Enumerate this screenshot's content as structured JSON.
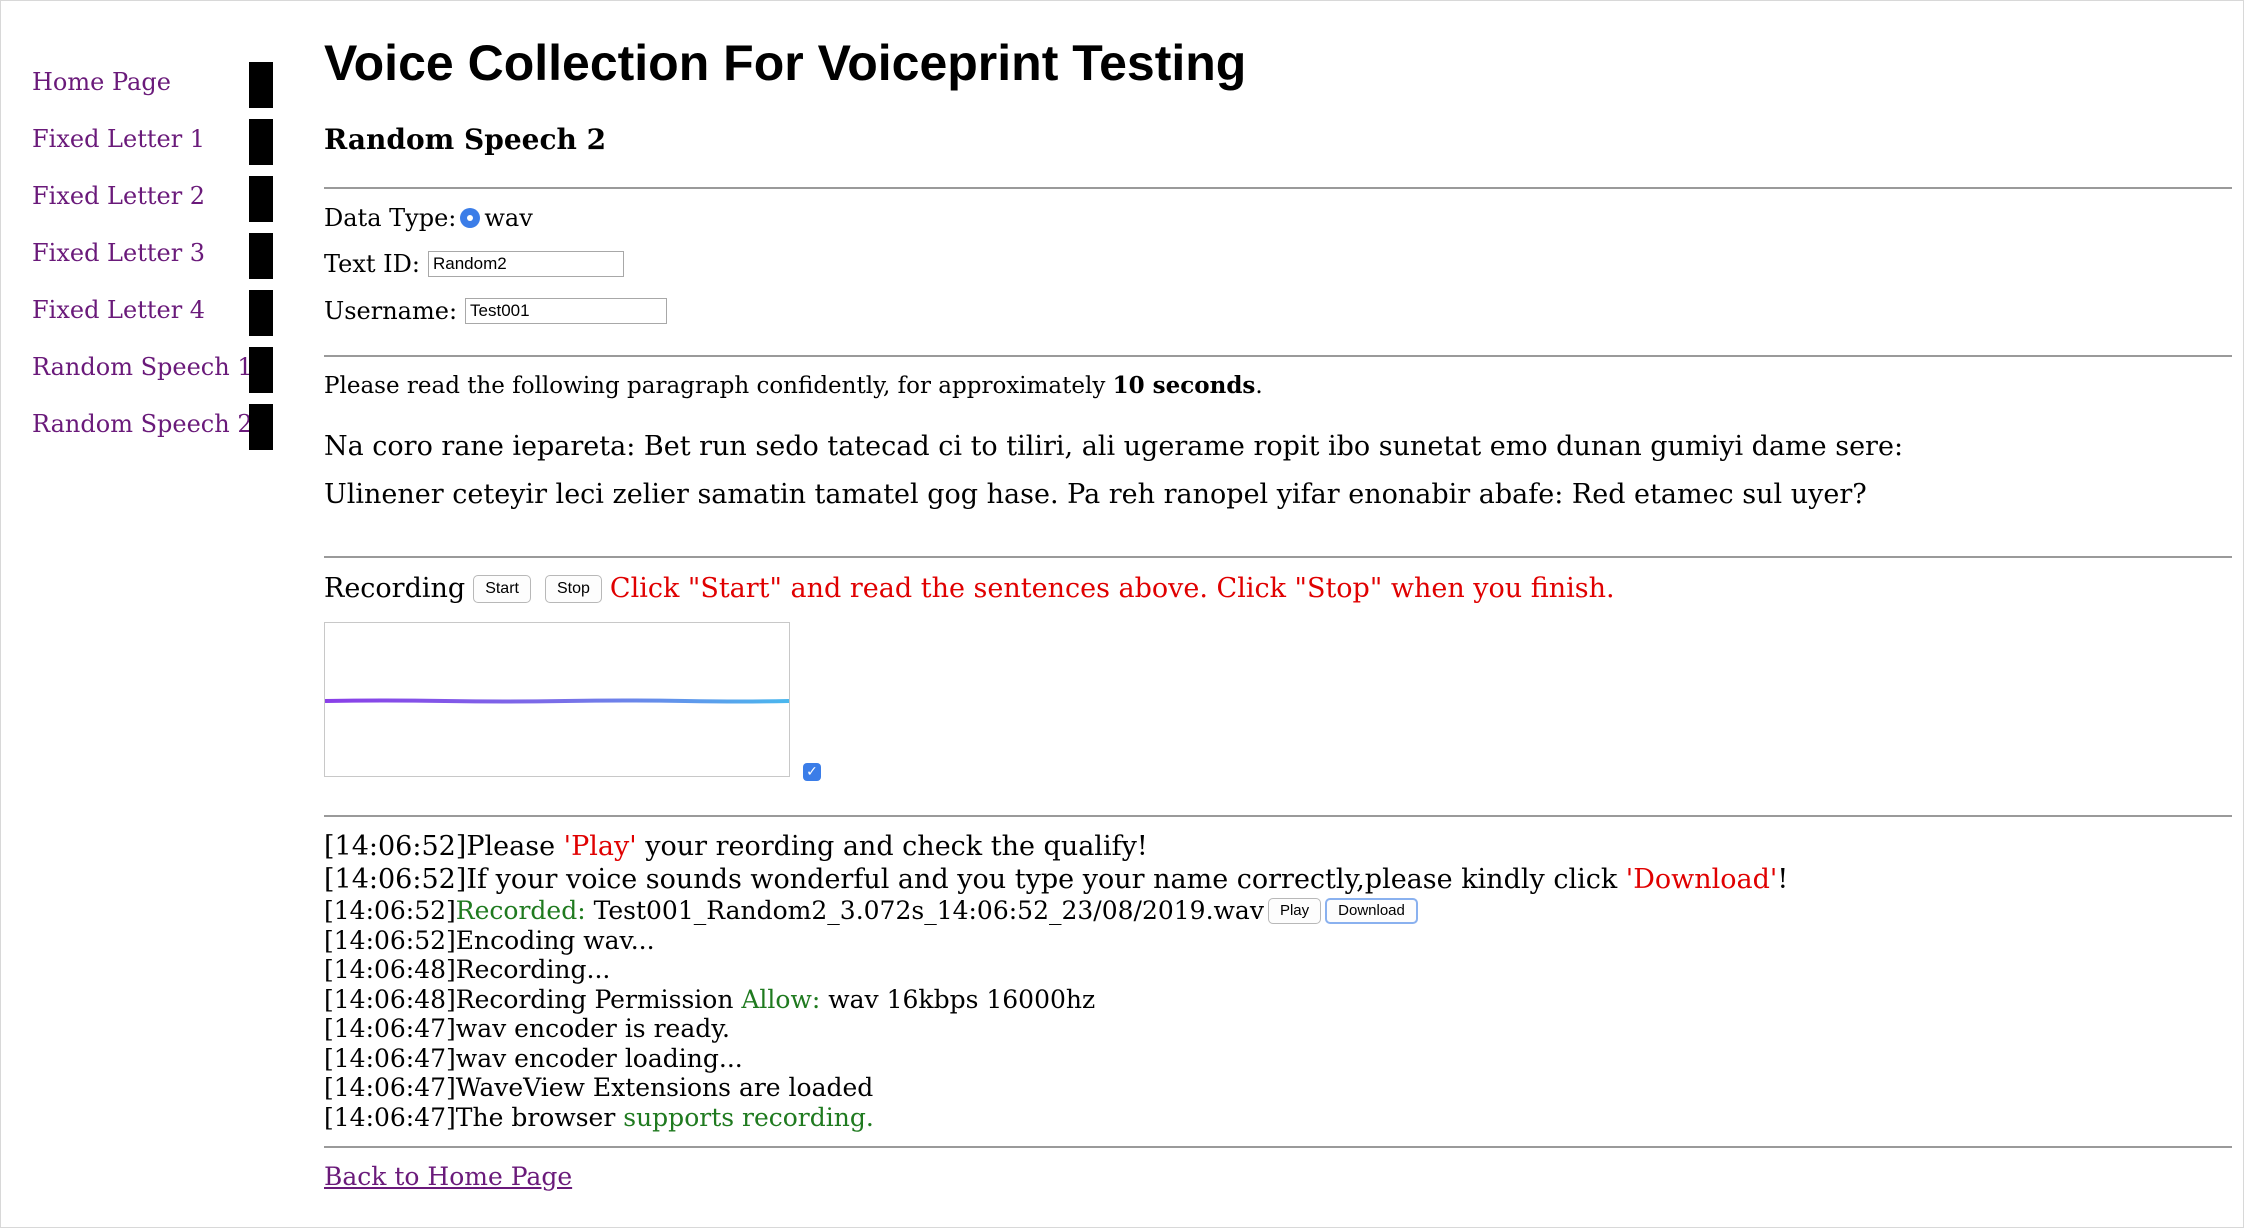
{
  "sidebar": {
    "items": [
      {
        "label": "Home Page"
      },
      {
        "label": "Fixed Letter 1"
      },
      {
        "label": "Fixed Letter 2"
      },
      {
        "label": "Fixed Letter 3"
      },
      {
        "label": "Fixed Letter 4"
      },
      {
        "label": "Random Speech 1"
      },
      {
        "label": "Random Speech 2"
      }
    ]
  },
  "page": {
    "title": "Voice Collection For Voiceprint Testing",
    "subtitle": "Random Speech 2"
  },
  "form": {
    "data_type_label": "Data Type:",
    "data_type_value": "wav",
    "text_id_label": "Text ID:",
    "text_id_value": "Random2",
    "username_label": "Username:",
    "username_value": "Test001"
  },
  "instructions": {
    "prefix": "Please read the following paragraph confidently, for approximately ",
    "duration": "10 seconds",
    "suffix": ".",
    "paragraph_line1": "Na coro rane iepareta: Bet run sedo tatecad ci to tiliri, ali ugerame ropit ibo sunetat emo dunan gumiyi dame sere:",
    "paragraph_line2": "Ulinener ceteyir leci zelier samatin tamatel gog hase. Pa reh ranopel yifar enonabir abafe: Red etamec sul uyer?"
  },
  "recording": {
    "label": "Recording",
    "start_label": "Start",
    "stop_label": "Stop",
    "hint": "Click \"Start\" and read the sentences above. Click \"Stop\" when you finish.",
    "waveview_enabled": true
  },
  "log": {
    "line1": {
      "time": "[14:06:52]",
      "a": "Please ",
      "b": "'Play'",
      "c": " your reording and check the qualify!"
    },
    "line2": {
      "time": "[14:06:52]",
      "a": "If your voice sounds wonderful and you type your name correctly,please kindly click ",
      "b": "'Download'",
      "c": "!"
    },
    "line3": {
      "time": "[14:06:52]",
      "a": "Recorded:",
      "b": " Test001_Random2_3.072s_14:06:52_23/08/2019.wav",
      "play": "Play",
      "download": "Download"
    },
    "line4": {
      "time": "[14:06:52]",
      "a": "Encoding wav..."
    },
    "line5": {
      "time": "[14:06:48]",
      "a": "Recording..."
    },
    "line6": {
      "time": "[14:06:48]",
      "a": "Recording Permission ",
      "b": "Allow:",
      "c": " wav 16kbps 16000hz"
    },
    "line7": {
      "time": "[14:06:47]",
      "a": "wav encoder is ready."
    },
    "line8": {
      "time": "[14:06:47]",
      "a": "wav encoder loading..."
    },
    "line9": {
      "time": "[14:06:47]",
      "a": "WaveView Extensions are loaded"
    },
    "line10": {
      "time": "[14:06:47]",
      "a": "The browser ",
      "b": "supports recording."
    }
  },
  "footer": {
    "back_label": "Back to Home Page"
  },
  "colors": {
    "link": "#6a1a7a",
    "alert": "#e00000",
    "ok": "#1f7a1f",
    "accent": "#3b7de8"
  }
}
